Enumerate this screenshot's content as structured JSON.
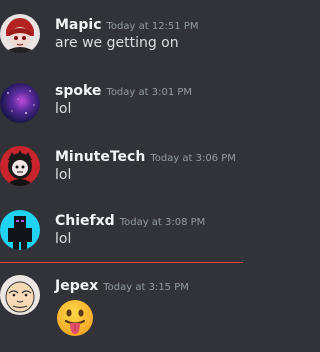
{
  "messages": [
    {
      "username": "Mapic",
      "timestamp": "Today at 12:51 PM",
      "text": "are we getting on",
      "avatar": "mapic-avatar"
    },
    {
      "username": "spoke",
      "timestamp": "Today at 3:01 PM",
      "text": "lol",
      "avatar": "spoke-avatar"
    },
    {
      "username": "MinuteTech",
      "timestamp": "Today at 3:06 PM",
      "text": "lol",
      "avatar": "minutetech-avatar"
    },
    {
      "username": "Chiefxd",
      "timestamp": "Today at 3:08 PM",
      "text": "lol",
      "avatar": "chiefxd-avatar"
    },
    {
      "username": "Jepex",
      "timestamp": "Today at 3:15 PM",
      "emoji": "tongue-out-face-emoji",
      "avatar": "jepex-avatar"
    }
  ],
  "colors": {
    "background": "#313338",
    "username": "#f2f3f5",
    "timestamp": "#949ba4",
    "message_text": "#dbdee1",
    "new_messages_divider": "#f23f43"
  }
}
